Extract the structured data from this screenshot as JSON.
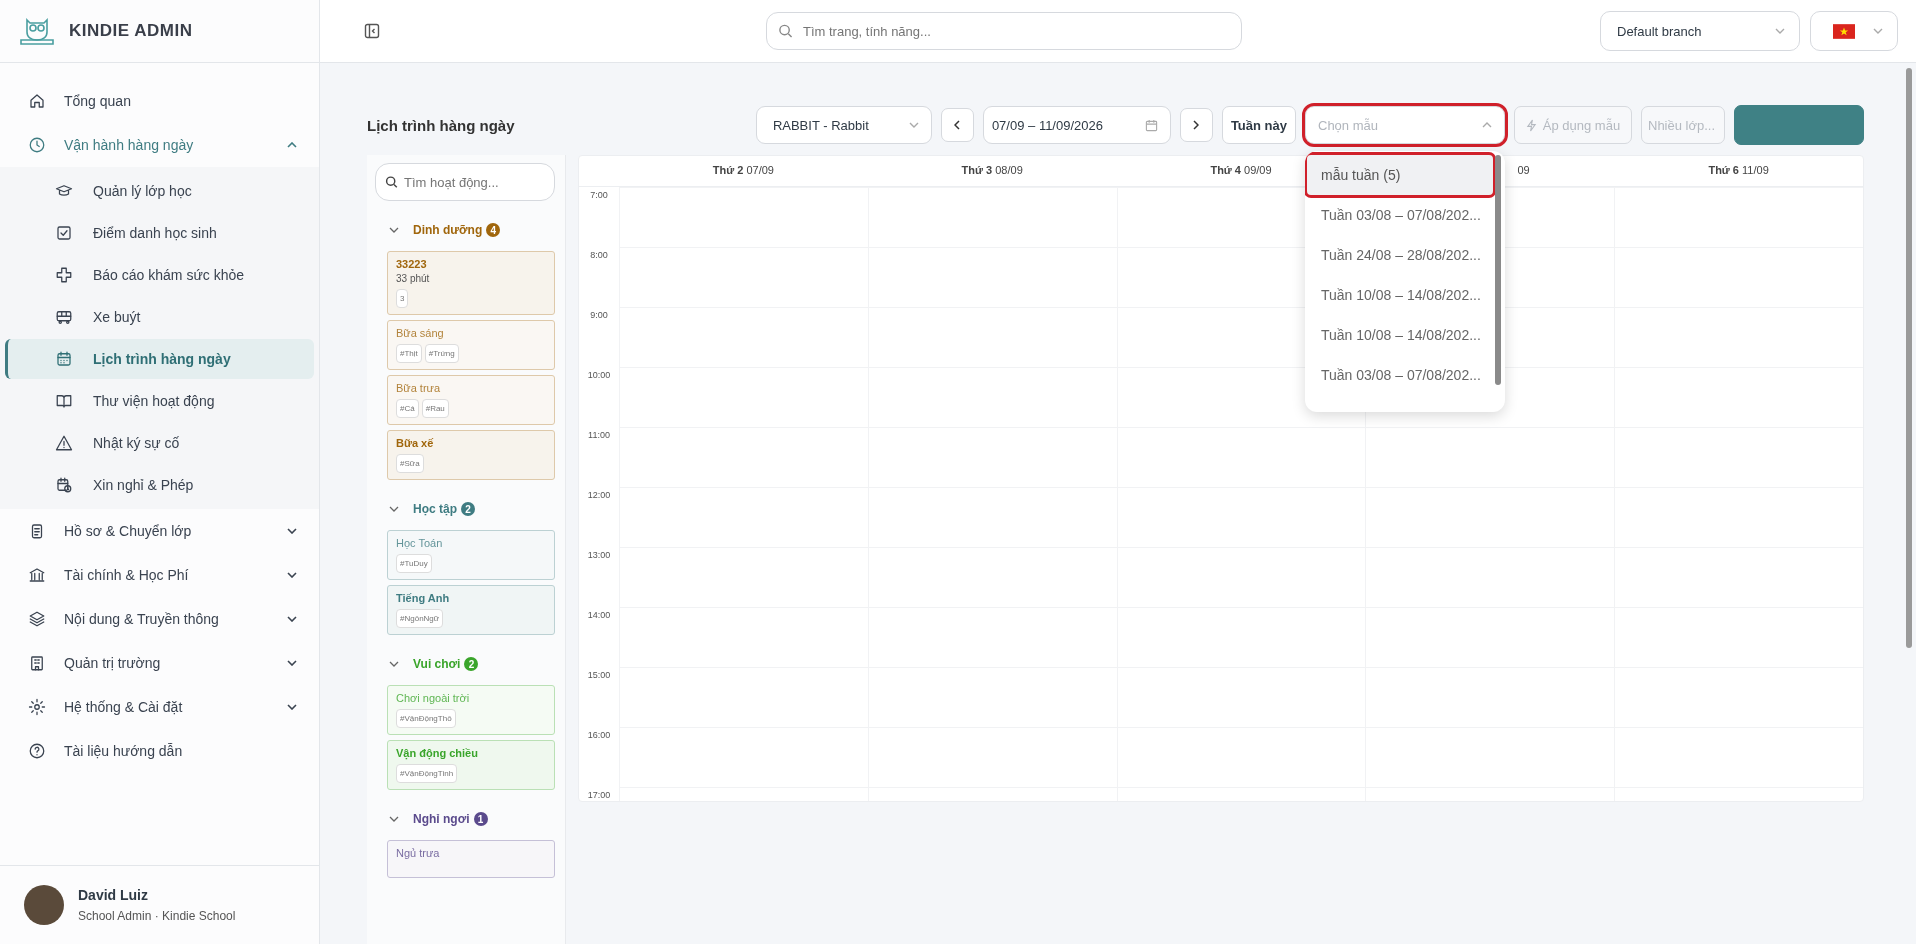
{
  "brand": {
    "name": "KINDIE ADMIN"
  },
  "search": {
    "placeholder": "Tìm trang, tính năng..."
  },
  "branch_select": {
    "value": "Default branch"
  },
  "sidebar": {
    "items": [
      {
        "label": "Tổng quan"
      },
      {
        "label": "Vận hành hàng ngày",
        "expanded": true,
        "children": [
          {
            "label": "Quản lý lớp học",
            "selected": false
          },
          {
            "label": "Điểm danh học sinh",
            "selected": false
          },
          {
            "label": "Báo cáo khám sức khỏe",
            "selected": false
          },
          {
            "label": "Xe buýt",
            "selected": false
          },
          {
            "label": "Lịch trình hàng ngày",
            "selected": true
          },
          {
            "label": "Thư viện hoạt động",
            "selected": false
          },
          {
            "label": "Nhật ký sự cố",
            "selected": false
          },
          {
            "label": "Xin nghỉ & Phép",
            "selected": false
          }
        ]
      },
      {
        "label": "Hồ sơ & Chuyển lớp",
        "expanded": false
      },
      {
        "label": "Tài chính & Học Phí",
        "expanded": false
      },
      {
        "label": "Nội dung & Truyền thông",
        "expanded": false
      },
      {
        "label": "Quản trị trường",
        "expanded": false
      },
      {
        "label": "Hệ thống & Cài đặt",
        "expanded": false
      },
      {
        "label": "Tài liệu hướng dẫn"
      }
    ]
  },
  "user": {
    "name": "David Luiz",
    "role": "School Admin · Kindie School"
  },
  "page": {
    "title": "Lịch trình hàng ngày"
  },
  "toolbar": {
    "class_select": "RABBIT - Rabbit",
    "date_range": "07/09 – 11/09/2026",
    "this_week_button": "Tuần này",
    "template_select": {
      "placeholder": "Chọn mẫu",
      "highlighted": true,
      "expanded": true
    },
    "apply_button": {
      "label": "Áp dụng mẫu",
      "disabled": true
    },
    "multi_class_button": {
      "label": "Nhiều lớp...",
      "disabled": true
    }
  },
  "template_options": [
    {
      "label": "mẫu tuần (5)",
      "hovered": true,
      "highlighted": true
    },
    {
      "label": "Tuần 03/08 – 07/08/202...",
      "hovered": false,
      "highlighted": false
    },
    {
      "label": "Tuần 24/08 – 28/08/202...",
      "hovered": false,
      "highlighted": false
    },
    {
      "label": "Tuần 10/08 – 14/08/202...",
      "hovered": false,
      "highlighted": false
    },
    {
      "label": "Tuần 10/08 – 14/08/202...",
      "hovered": false,
      "highlighted": false
    },
    {
      "label": "Tuần 03/08 – 07/08/202...",
      "hovered": false,
      "highlighted": false
    }
  ],
  "activity_search": {
    "placeholder": "Tìm hoạt động..."
  },
  "activity_groups": [
    {
      "name": "Dinh dưỡng",
      "count": "4",
      "color": "#a0660c",
      "expanded": true,
      "items": [
        {
          "title": "33223",
          "duration": "33 phút",
          "tags": [
            "3"
          ],
          "faded": false
        },
        {
          "title": "Bữa sáng",
          "tags": [
            "#Thịt",
            "#Trứng"
          ],
          "faded": true
        },
        {
          "title": "Bữa trưa",
          "tags": [
            "#Cá",
            "#Rau"
          ],
          "faded": true
        },
        {
          "title": "Bữa xế",
          "tags": [
            "#Sữa"
          ],
          "faded": false
        }
      ]
    },
    {
      "name": "Học tập",
      "count": "2",
      "color": "#3f7c82",
      "expanded": true,
      "items": [
        {
          "title": "Học Toán",
          "tags": [
            "#TuDuy"
          ],
          "faded": true
        },
        {
          "title": "Tiếng Anh",
          "tags": [
            "#NgônNgữ"
          ],
          "faded": false
        }
      ]
    },
    {
      "name": "Vui chơi",
      "count": "2",
      "color": "#3aa52b",
      "expanded": true,
      "items": [
        {
          "title": "Chơi ngoài trời",
          "tags": [
            "#VậnĐộngThô"
          ],
          "faded": true
        },
        {
          "title": "Vận động chiều",
          "tags": [
            "#VậnĐộngTinh"
          ],
          "faded": false
        }
      ]
    },
    {
      "name": "Nghỉ ngơi",
      "count": "1",
      "color": "#5a4a8c",
      "expanded": true,
      "items": [
        {
          "title": "Ngủ trưa",
          "faded": true
        }
      ]
    }
  ],
  "calendar": {
    "days": [
      {
        "day": "Thứ 2",
        "date": "07/09"
      },
      {
        "day": "Thứ 3",
        "date": "08/09"
      },
      {
        "day": "Thứ 4",
        "date": "09/09"
      },
      {
        "date": "09"
      },
      {
        "day": "Thứ 6",
        "date": "11/09"
      }
    ],
    "hours": [
      "7:00",
      "8:00",
      "9:00",
      "10:00",
      "11:00",
      "12:00",
      "13:00",
      "14:00",
      "15:00",
      "16:00",
      "17:00"
    ]
  }
}
